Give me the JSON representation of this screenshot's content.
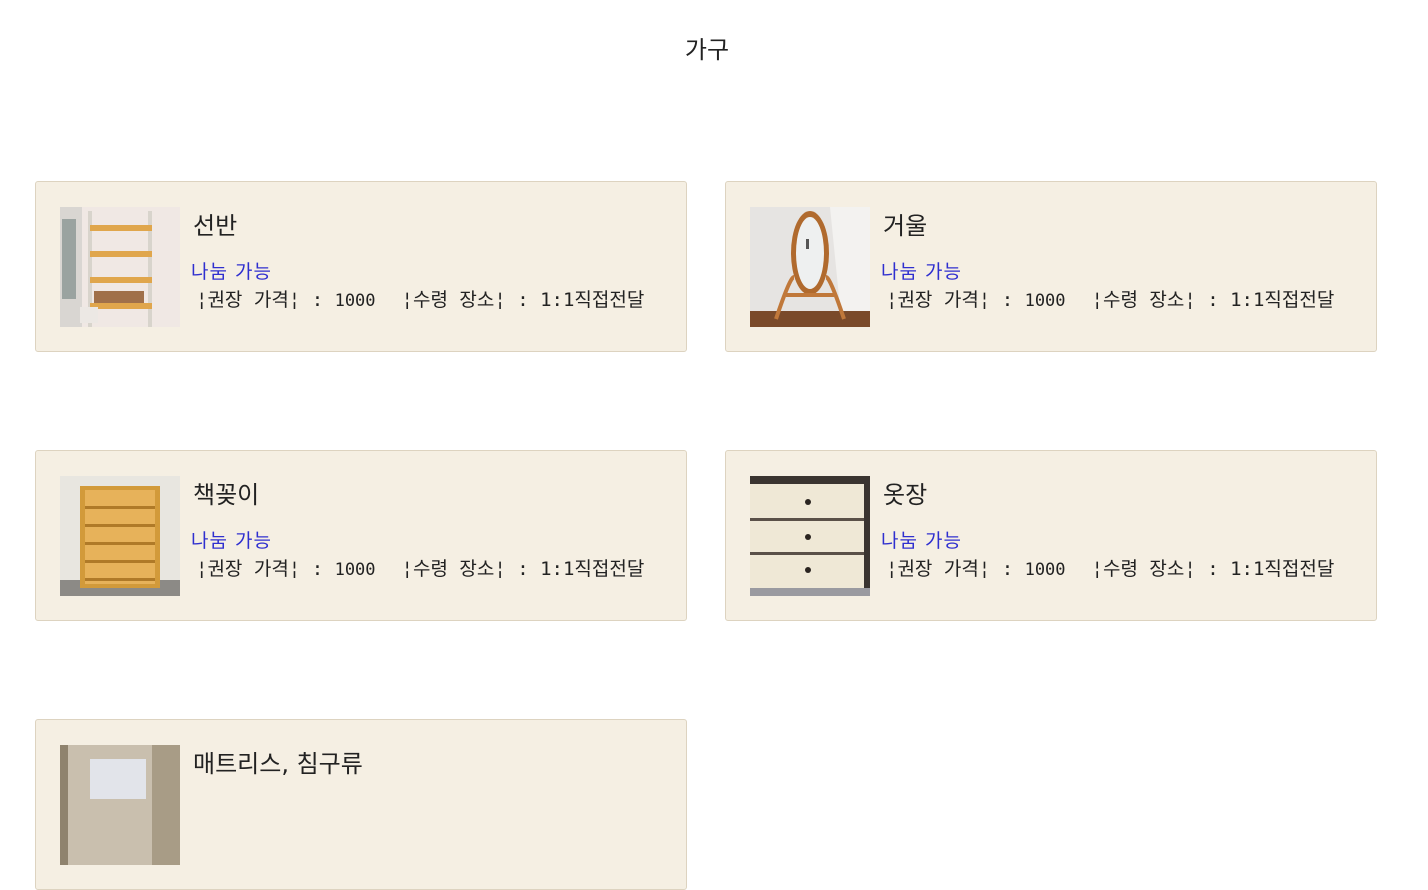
{
  "page": {
    "title": "가구"
  },
  "items": [
    {
      "title": "선반",
      "status": "나눔 가능",
      "price_label": "¦권장 가격¦",
      "price_value": "1000",
      "place_label": "¦수령 장소¦",
      "place_value": "1:1직접전달",
      "image": "shelf-photo"
    },
    {
      "title": "거울",
      "status": "나눔 가능",
      "price_label": "¦권장 가격¦",
      "price_value": "1000",
      "place_label": "¦수령 장소¦",
      "place_value": "1:1직접전달",
      "image": "mirror-photo"
    },
    {
      "title": "책꽂이",
      "status": "나눔 가능",
      "price_label": "¦권장 가격¦",
      "price_value": "1000",
      "place_label": "¦수령 장소¦",
      "place_value": "1:1직접전달",
      "image": "bookshelf-photo"
    },
    {
      "title": "옷장",
      "status": "나눔 가능",
      "price_label": "¦권장 가격¦",
      "price_value": "1000",
      "place_label": "¦수령 장소¦",
      "place_value": "1:1직접전달",
      "image": "drawer-photo"
    },
    {
      "title": "매트리스, 침구류",
      "image": "mattress-photo"
    }
  ],
  "colors": {
    "card_background": "#f5efe3",
    "card_border": "#ddd3c0",
    "status_text": "#2f2fcf"
  }
}
